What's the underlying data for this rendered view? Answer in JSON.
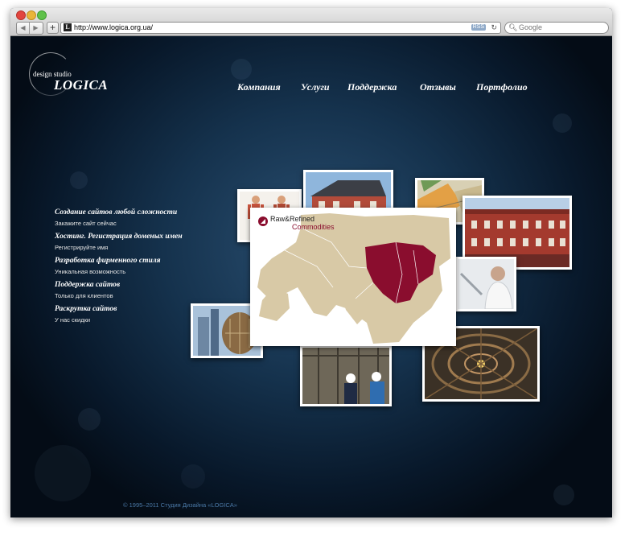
{
  "browser": {
    "url": "http://www.logica.org.ua/",
    "rss_label": "RSS",
    "search_placeholder": "Google",
    "new_tab_label": "+",
    "back_symbol": "◀",
    "forward_symbol": "▶",
    "reload_symbol": "↻",
    "favicon_letter": "L"
  },
  "logo": {
    "line1": "design studio",
    "line2": "LOGICA"
  },
  "nav": [
    "Компания",
    "Услуги",
    "Поддержка",
    "Отзывы",
    "Портфолио"
  ],
  "services": [
    {
      "title": "Создание сайтов любой сложности",
      "subtitle": "Закажите сайт сейчас"
    },
    {
      "title": "Хостинг. Регистрация доменых имен",
      "subtitle": "Регистрируйте имя"
    },
    {
      "title": "Разработка фирменного стиля",
      "subtitle": "Уникальная возможность"
    },
    {
      "title": "Поддержка сайтов",
      "subtitle": "Только для клиентов"
    },
    {
      "title": "Раскрутка сайтов",
      "subtitle": "У нас скидки"
    }
  ],
  "portfolio": {
    "main_brand_line1": "Raw&Refined",
    "main_brand_line2": "Commodities",
    "map_colors": {
      "sea": "#ffffff",
      "land": "#d8c9a6",
      "highlight": "#8a0d2e"
    }
  },
  "footer": "© 1995–2011 Студия Дизайна «LOGICA»"
}
